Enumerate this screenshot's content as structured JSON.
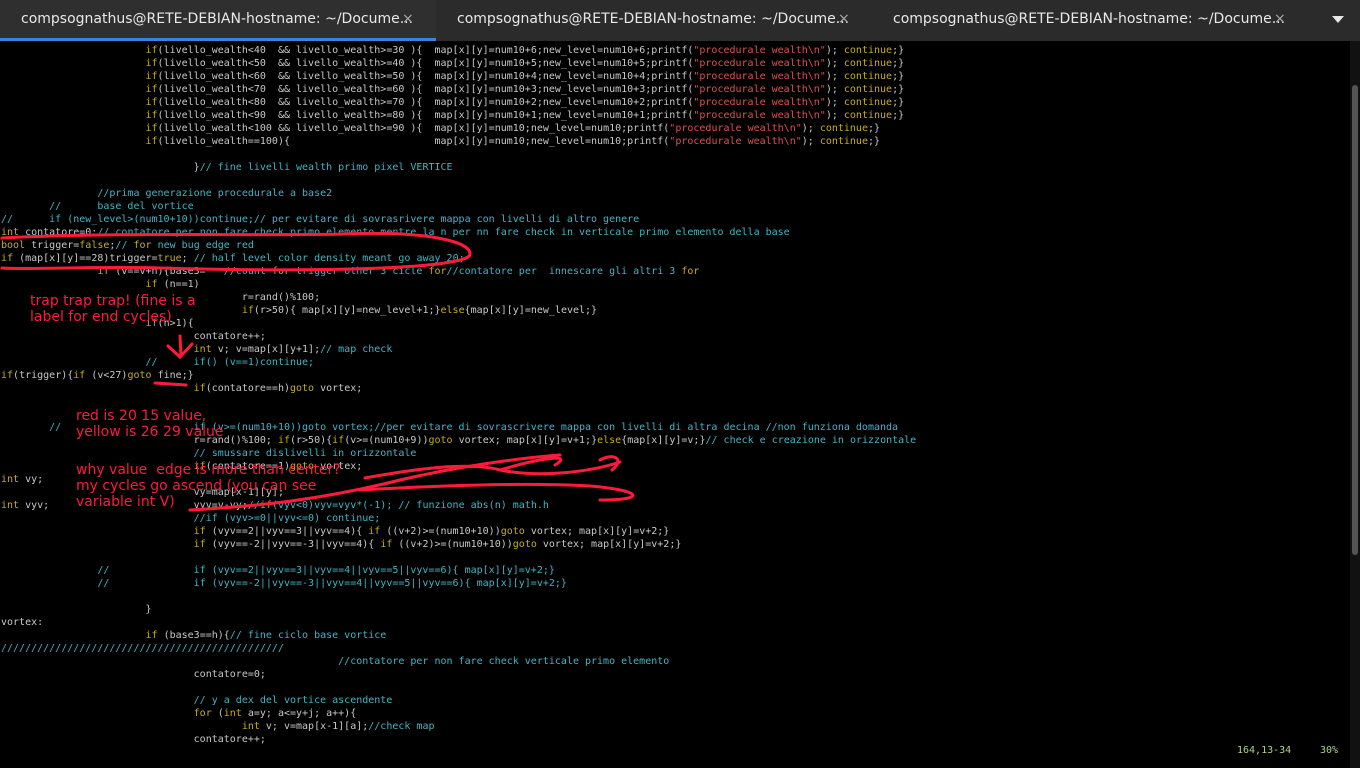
{
  "tabs": [
    {
      "label": "compsognathus@RETE-DEBIAN-hostname: ~/Docume...",
      "active": true
    },
    {
      "label": "compsognathus@RETE-DEBIAN-hostname: ~/Docume...",
      "active": false
    },
    {
      "label": "compsognathus@RETE-DEBIAN-hostname: ~/Docume...",
      "active": false
    }
  ],
  "tab_close_glyph": "×",
  "code_lines": [
    "                        if(livello_wealth<40  && livello_wealth>=30 ){  map[x][y]=num10+6;new_level=num10+6;printf(\"procedurale wealth\\n\"); continue;}",
    "                        if(livello_wealth<50  && livello_wealth>=40 ){  map[x][y]=num10+5;new_level=num10+5;printf(\"procedurale wealth\\n\"); continue;}",
    "                        if(livello_wealth<60  && livello_wealth>=50 ){  map[x][y]=num10+4;new_level=num10+4;printf(\"procedurale wealth\\n\"); continue;}",
    "                        if(livello_wealth<70  && livello_wealth>=60 ){  map[x][y]=num10+3;new_level=num10+3;printf(\"procedurale wealth\\n\"); continue;}",
    "                        if(livello_wealth<80  && livello_wealth>=70 ){  map[x][y]=num10+2;new_level=num10+2;printf(\"procedurale wealth\\n\"); continue;}",
    "                        if(livello_wealth<90  && livello_wealth>=80 ){  map[x][y]=num10+1;new_level=num10+1;printf(\"procedurale wealth\\n\"); continue;}",
    "                        if(livello_wealth<100 && livello_wealth>=90 ){  map[x][y]=num10;new_level=num10;printf(\"procedurale wealth\\n\"); continue;}",
    "                        if(livello_wealth==100){                        map[x][y]=num10;new_level=num10;printf(\"procedurale wealth\\n\"); continue;}",
    "",
    "                                }// fine livelli wealth primo pixel VERTICE",
    "",
    "                //prima generazione procedurale a base2",
    "        //      base del vortice",
    "//      if (new_level>(num10+10))continue;// per evitare di sovrasrivere mappa con livelli di altro genere",
    "int contatore=0;// contatore per non fare check primo elemento mentre la n per nn fare check in verticale primo elemento della base",
    "bool trigger=false;// for new bug edge red",
    "if (map[x][y]==28)trigger=true; // half level color density meant go away 20;",
    "                if (v==v+n){base3=   //count for trigger other 3 cicle for//contatore per  innescare gli altri 3 for",
    "                        if (n==1)",
    "                                        r=rand()%100;",
    "                                        if(r>50){ map[x][y]=new_level+1;}else{map[x][y]=new_level;}",
    "                        if(n>1){",
    "                                contatore++;",
    "                                int v; v=map[x][y+1];// map check",
    "                        //      if() (v==1)continue;",
    "if(trigger){if (v<27)goto fine;}",
    "                                if(contatore==h)goto vortex;",
    "",
    "",
    "        //                      if (v>=(num10+10))goto vortex;//per evitare di sovrascrivere mappa con livelli di altra decina //non funziona domanda",
    "                                r=rand()%100; if(r>50){if(v>=(num10+9))goto vortex; map[x][y]=v+1;}else{map[x][y]=v;}// check e creazione in orizzontale",
    "                                // smussare dislivelli in orizzontale",
    "                                if(contatore==1)goto vortex;",
    "int vy;",
    "                                vy=map[x-1][y];",
    "int vyv;                        vyv=v-vy;//if(vyv<0)vyv=vyv*(-1); // funzione abs(n) math.h",
    "                                //if (vyv>=0||vyv<=0) continue;",
    "                                if (vyv==2||vyv==3||vyv==4){ if ((v+2)>=(num10+10))goto vortex; map[x][y]=v+2;}",
    "                                if (vyv==-2||vyv==-3||vyv==4){ if ((v+2)>=(num10+10))goto vortex; map[x][y]=v+2;}",
    "",
    "                //              if (vyv==2||vyv==3||vyv==4||vyv==5||vyv==6){ map[x][y]=v+2;}",
    "                //              if (vyv==-2||vyv==-3||vyv==4||vyv==5||vyv==6){ map[x][y]=v+2;}",
    "",
    "                        }",
    "vortex:",
    "                        if (base3==h){// fine ciclo base vortice",
    "///////////////////////////////////////////////",
    "                                                        //contatore per non fare check verticale primo elemento",
    "                                contatore=0;",
    "",
    "                                // y a dex del vortice ascendente",
    "                                for (int a=y; a<=y+j; a++){",
    "                                        int v; v=map[x-1][a];//check map",
    "                                contatore++;"
  ],
  "status": {
    "position": "164,13-34",
    "percent": "30%"
  },
  "annotations": {
    "trap": "trap trap trap! (fine is a\nlabel for end cycles)",
    "colors": "red is 20 15 value,\nyellow is 26 29 value",
    "question": "why value  edge is more than center?\nmy cycles go ascend (you can see\nvariable int V)"
  }
}
